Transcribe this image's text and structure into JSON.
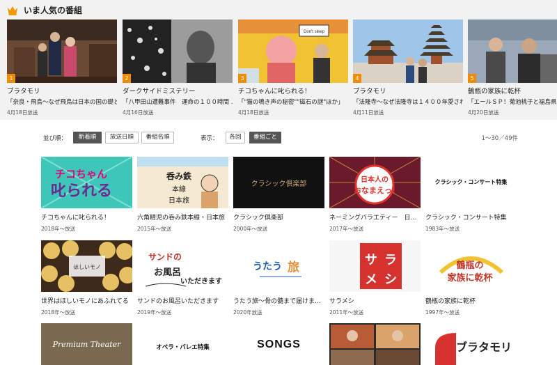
{
  "popular": {
    "title": "いま人気の番組",
    "items": [
      {
        "rank": "1",
        "title": "ブラタモリ",
        "desc": "「奈良・飛鳥～なぜ飛鳥は日本の国の礎と…",
        "date": "4月18日放送"
      },
      {
        "rank": "2",
        "title": "ダークサイドミステリー",
        "desc": "「八甲田山遭難事件　運命の１００時間 …",
        "date": "4月16日放送"
      },
      {
        "rank": "3",
        "title": "チコちゃんに叱られる！",
        "desc": "「\"猫の鳴き声の秘密\"\"磁石の謎\"ほか」",
        "date": "4月18日放送"
      },
      {
        "rank": "4",
        "title": "ブラタモリ",
        "desc": "「法隆寺～なぜ法隆寺は１４００年愛され…",
        "date": "4月11日放送"
      },
      {
        "rank": "5",
        "title": "鶴瓶の家族に乾杯",
        "desc": "「エールＳＰ！菊池桃子と福島県…",
        "date": "4月20日放送"
      }
    ]
  },
  "controls": {
    "sort_label": "並び順：",
    "sort_options": [
      "新着順",
      "放送日順",
      "番組名順"
    ],
    "view_label": "表示：",
    "view_options": [
      "各回",
      "番組ごと"
    ],
    "count": "1～30／49件"
  },
  "programs": [
    {
      "title": "チコちゃんに叱られる！",
      "year": "2018年～放送",
      "art": "チコちゃんに叱られる"
    },
    {
      "title": "六角精児の呑み鉄本線・日本旅",
      "year": "2015年～放送",
      "art": "呑み鉄本線日本旅"
    },
    {
      "title": "クラシック倶楽部",
      "year": "2000年～放送",
      "art": "クラシック倶楽部"
    },
    {
      "title": "ネーミングバラエティー　日…",
      "year": "2017年～放送",
      "art": "日本人のおなまえっ！"
    },
    {
      "title": "クラシック・コンサート特集",
      "year": "1983年～放送",
      "art": "クラシック・コンサート特集"
    },
    {
      "title": "世界はほしいモノにあふれてる",
      "year": "2018年～放送",
      "art": "世界はほしいモノにあふれてる"
    },
    {
      "title": "サンドのお風呂いただきます",
      "year": "2019年～放送",
      "art": "サンドのお風呂いただきます"
    },
    {
      "title": "うたう旅～骨の髄まで届けま…",
      "year": "2020年放送",
      "art": "うたう旅"
    },
    {
      "title": "サラメシ",
      "year": "2011年～放送",
      "art": "サラメシ"
    },
    {
      "title": "鶴瓶の家族に乾杯",
      "year": "1997年～放送",
      "art": "鶴瓶の家族に乾杯"
    },
    {
      "title": "",
      "year": "",
      "art": "Premium Theater"
    },
    {
      "title": "",
      "year": "",
      "art": "オペラ・バレエ特集"
    },
    {
      "title": "",
      "year": "",
      "art": "SONGS"
    },
    {
      "title": "",
      "year": "",
      "art": ""
    },
    {
      "title": "",
      "year": "",
      "art": "ブラタモリ"
    }
  ],
  "colors": {
    "rank_badge": "#f08c00",
    "active_button": "#555555",
    "section_bg": "#f2f2f2"
  }
}
